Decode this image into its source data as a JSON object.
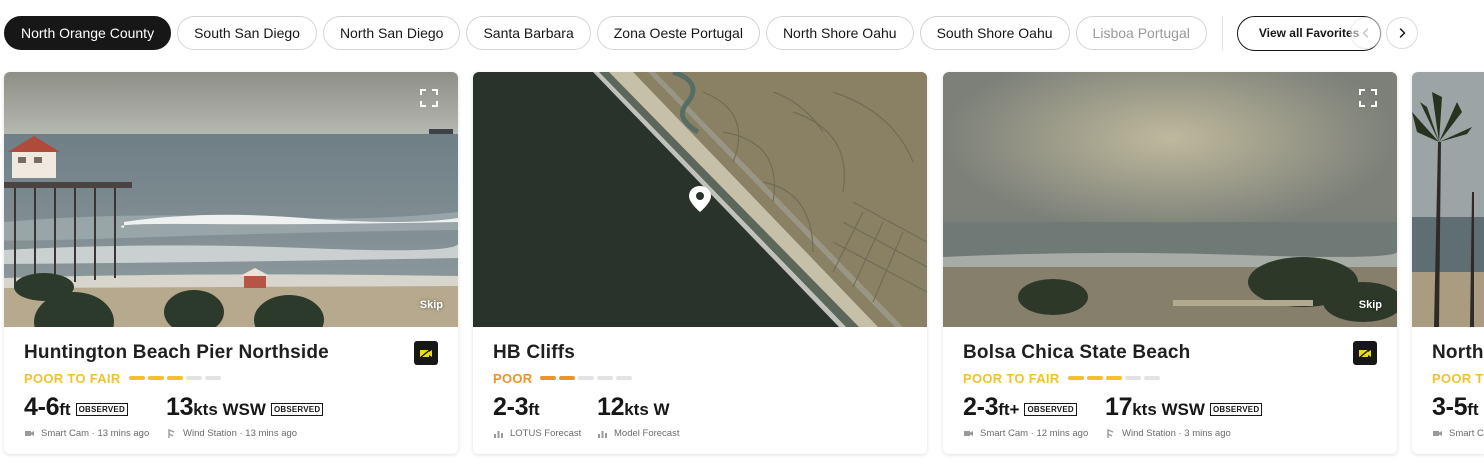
{
  "chips": [
    "North Orange County",
    "South San Diego",
    "North San Diego",
    "Santa Barbara",
    "Zona Oeste Portugal",
    "North Shore Oahu",
    "South Shore Oahu",
    "Lisboa Portugal"
  ],
  "view_all_label": "View all Favorites",
  "skip_label": "Skip",
  "observed_badge": "OBSERVED",
  "colors": {
    "fair": "#f2c12e",
    "poor": "#f0922b",
    "inactive": "#e3e3e3",
    "ink": "#171717"
  },
  "cards": [
    {
      "title": "Huntington Beach Pier Northside",
      "condition": "POOR TO FAIR",
      "condition_level": 3,
      "wave_height": "4-6",
      "wave_unit": "ft",
      "wind_speed": "13",
      "wind_unit": "kts WSW",
      "wave_source": "Smart Cam · 13 mins ago",
      "wind_source": "Wind Station · 13 mins ago"
    },
    {
      "title": "HB Cliffs",
      "condition": "POOR",
      "condition_level": 2,
      "wave_height": "2-3",
      "wave_unit": "ft",
      "wind_speed": "12",
      "wind_unit": "kts W",
      "wave_source": "LOTUS Forecast",
      "wind_source": "Model Forecast"
    },
    {
      "title": "Bolsa Chica State Beach",
      "condition": "POOR TO FAIR",
      "condition_level": 3,
      "wave_height": "2-3",
      "wave_unit": "ft+",
      "wind_speed": "17",
      "wind_unit": "kts WSW",
      "wave_source": "Smart Cam · 12 mins ago",
      "wind_source": "Wind Station · 3 mins ago"
    },
    {
      "title": "North",
      "condition": "POOR T",
      "wave_height": "3-5",
      "wave_unit": "ft",
      "wave_source": "Smart C"
    }
  ]
}
